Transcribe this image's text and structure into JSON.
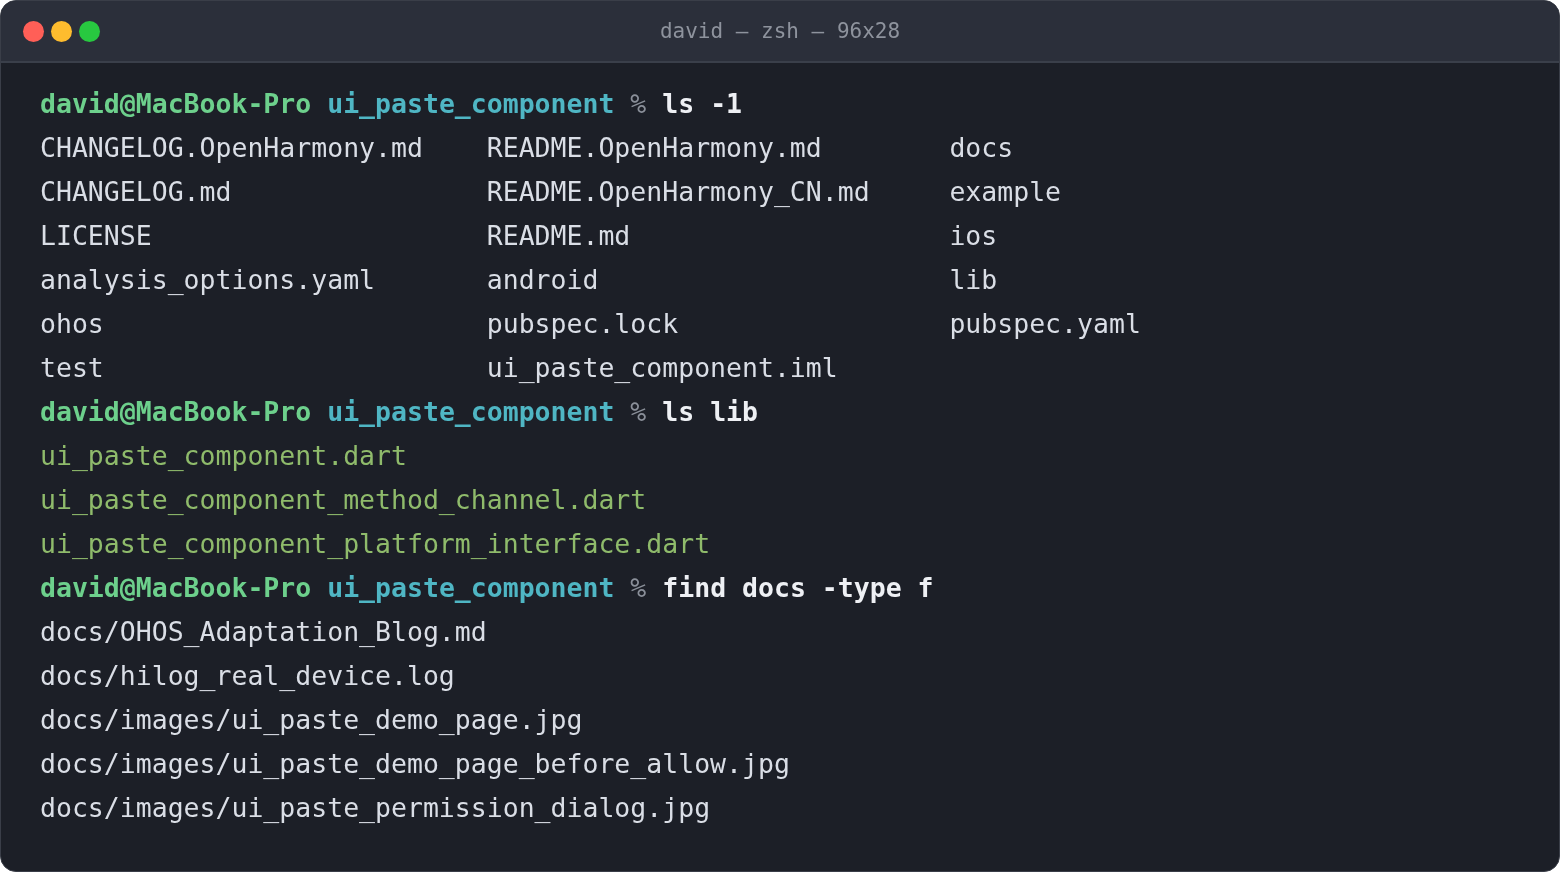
{
  "window": {
    "title": "david — zsh — 96x28"
  },
  "lines": [
    {
      "kind": "prompt",
      "user": "david@MacBook-Pro",
      "directory": "ui_paste_component",
      "symbol": "%",
      "command": "ls -1"
    },
    {
      "kind": "listing",
      "rows": [
        [
          "CHANGELOG.OpenHarmony.md",
          "README.OpenHarmony.md",
          "docs"
        ],
        [
          "CHANGELOG.md",
          "README.OpenHarmony_CN.md",
          "example"
        ],
        [
          "LICENSE",
          "README.md",
          "ios"
        ],
        [
          "analysis_options.yaml",
          "android",
          "lib"
        ],
        [
          "ohos",
          "pubspec.lock",
          "pubspec.yaml"
        ],
        [
          "test",
          "ui_paste_component.iml"
        ]
      ]
    },
    {
      "kind": "prompt",
      "user": "david@MacBook-Pro",
      "directory": "ui_paste_component",
      "symbol": "%",
      "command": "ls lib"
    },
    {
      "kind": "output",
      "text": "ui_paste_component.dart",
      "color": "#8fbb6b"
    },
    {
      "kind": "output",
      "text": "ui_paste_component_method_channel.dart",
      "color": "#8fbb6b"
    },
    {
      "kind": "output",
      "text": "ui_paste_component_platform_interface.dart",
      "color": "#8fbb6b"
    },
    {
      "kind": "prompt",
      "user": "david@MacBook-Pro",
      "directory": "ui_paste_component",
      "symbol": "%",
      "command": "find docs -type f"
    },
    {
      "kind": "output",
      "text": "docs/OHOS_Adaptation_Blog.md",
      "color": "#dadee6"
    },
    {
      "kind": "output",
      "text": "docs/hilog_real_device.log",
      "color": "#dadee6"
    },
    {
      "kind": "output",
      "text": "docs/images/ui_paste_demo_page.jpg",
      "color": "#dadee6"
    },
    {
      "kind": "output",
      "text": "docs/images/ui_paste_demo_page_before_allow.jpg",
      "color": "#dadee6"
    },
    {
      "kind": "output",
      "text": "docs/images/ui_paste_permission_dialog.jpg",
      "color": "#dadee6"
    }
  ]
}
